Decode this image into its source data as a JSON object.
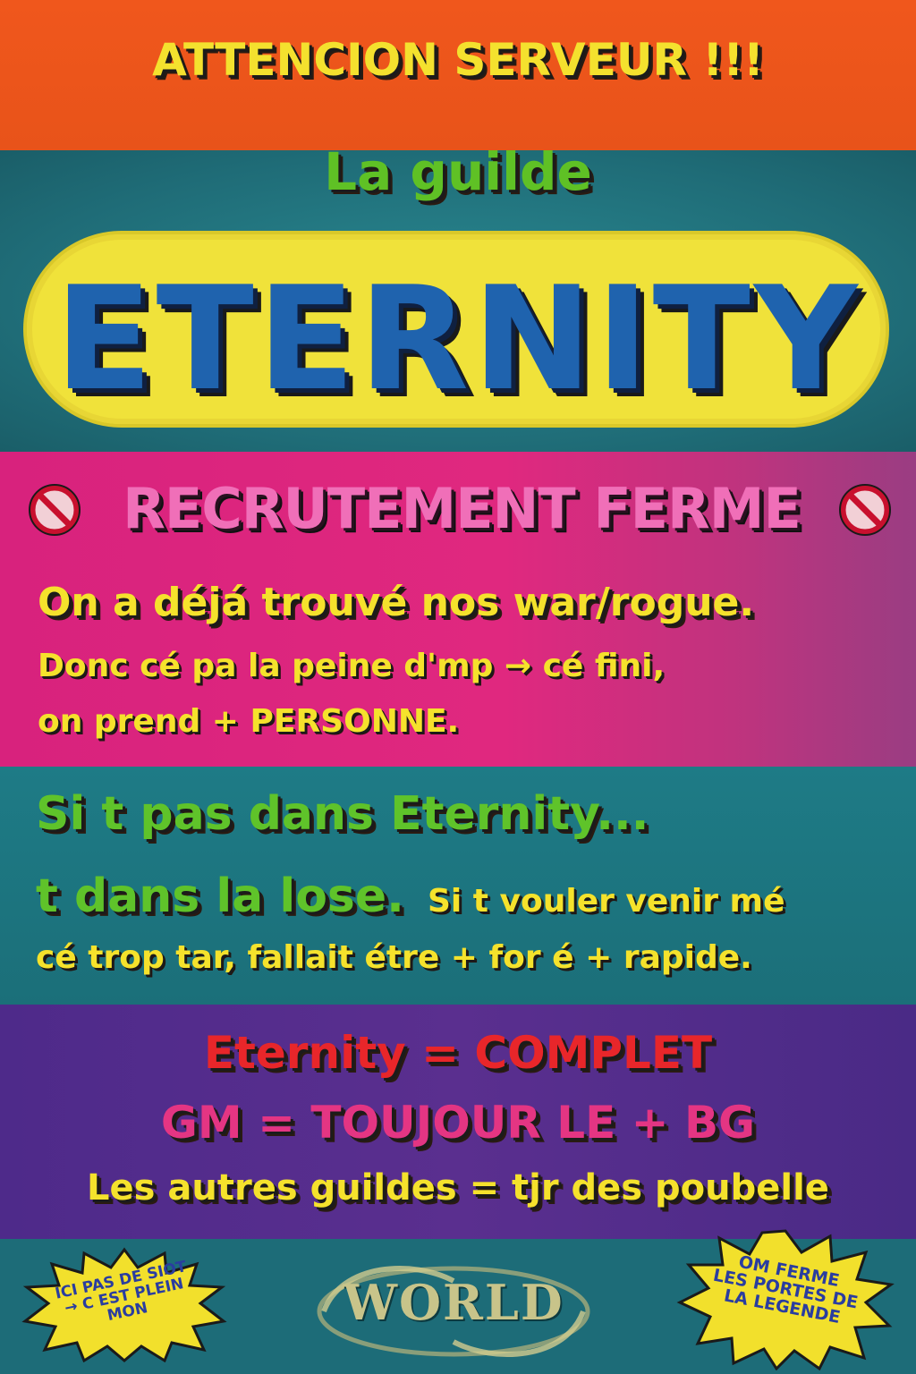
{
  "header": {
    "announcement": "ATTENCION SERVEUR !!!",
    "subtitle": "La guilde",
    "guild_name": "ETERNITY"
  },
  "recruitment": {
    "title": "RECRUTEMENT FERME",
    "ban_icon": "no-entry-sign-icon",
    "line1": "On a déjá trouvé nos war/rogue.",
    "line2": "Donc cé pa la peine d'mp → cé fini,",
    "line3": "on prend + PERSONNE."
  },
  "message": {
    "line1": "Si t pas dans Eternity...",
    "line2": "t dans la lose.",
    "line2_tail": "Si t vouler venir mé",
    "line3": "cé trop tar, fallait étre + for é + rapide."
  },
  "status": {
    "complet": "Eternity = COMPLET",
    "gm": "GM = TOUJOUR LE + BG",
    "others": "Les autres guildes = tjr des poubelle"
  },
  "footer": {
    "left_burst": [
      "ICI PAS DE SIOT",
      "→ C EST PLEIN",
      "MON"
    ],
    "right_burst": [
      "OM FERME",
      "LES PORTES DE",
      "LA LEGENDE"
    ],
    "logo_text": "WORLD"
  },
  "colors": {
    "orange": "#e8531a",
    "teal": "#1f6c77",
    "yellow": "#f0e23a",
    "blue": "#1f63ae",
    "pink": "#e0287f",
    "purple": "#5a2f8f",
    "green": "#5fc125",
    "red": "#e8262a"
  }
}
